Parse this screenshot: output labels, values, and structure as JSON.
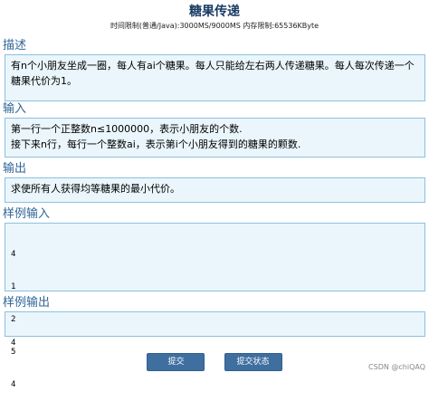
{
  "problem": {
    "title": "糖果传递",
    "limits": "时间限制(普通/Java):3000MS/9000MS 内存限制:65536KByte"
  },
  "sections": {
    "description": {
      "heading": "描述",
      "text": "有n个小朋友坐成一圈，每人有ai个糖果。每人只能给左右两人传递糖果。每人每次传递一个糖果代价为1。"
    },
    "input": {
      "heading": "输入",
      "line1": "第一行一个正整数n≤1000000，表示小朋友的个数.",
      "line2": "接下来n行，每行一个整数ai，表示第i个小朋友得到的糖果的颗数."
    },
    "output": {
      "heading": "输出",
      "text": "求使所有人获得均等糖果的最小代价。"
    },
    "sample_input": {
      "heading": "样例输入",
      "lines": [
        "4",
        "1",
        "2",
        "5",
        "4"
      ]
    },
    "sample_output": {
      "heading": "样例输出",
      "lines": [
        "4"
      ]
    }
  },
  "buttons": {
    "submit": "提交",
    "status": "提交状态"
  },
  "watermark": "CSDN @chiQAQ"
}
